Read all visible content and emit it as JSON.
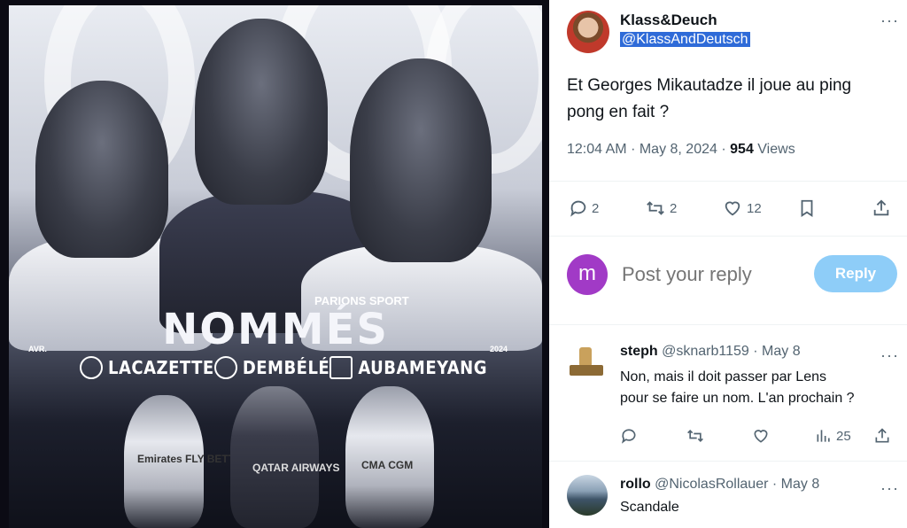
{
  "media": {
    "headline": "NOMMÉS",
    "players": [
      "LACAZETTE",
      "DEMBÉLÉ",
      "AUBAMEYANG"
    ],
    "sponsor": "PARIONS SPORT",
    "left_tag": "AVR.",
    "right_tag": "2024",
    "jersey_texts": [
      "Emirates FLY BETTER",
      "QATAR AIRWAYS",
      "CMA CGM"
    ]
  },
  "tweet": {
    "author_name": "Klass&Deuch",
    "author_handle": "@KlassAndDeutsch",
    "text_line1": "Et Georges Mikautadze il joue au ping",
    "text_line2": "pong en fait ?",
    "time": "12:04 AM",
    "date": "May 8, 2024",
    "sep": "·",
    "views_count": "954",
    "views_label": "Views",
    "replies": "2",
    "reposts": "2",
    "likes": "12",
    "more": "···"
  },
  "composer": {
    "avatar_letter": "m",
    "placeholder": "Post your reply",
    "button": "Reply",
    "avatar_color": "#a13ac6",
    "button_color": "#8ecdf8"
  },
  "replies": [
    {
      "name": "steph",
      "handle": "@sknarb1159",
      "date": "· May 8",
      "line1": "Non, mais il doit passer par Lens",
      "line2": "pour se faire un nom. L'an prochain ?",
      "views": "25"
    },
    {
      "name": "rollo",
      "handle": "@NicolasRollauer",
      "date": "· May 8",
      "line1": "Scandale"
    }
  ],
  "colors": {
    "accent": "#1d9bf0",
    "muted": "#536471",
    "selection": "#2f6bd8"
  },
  "icons": [
    "more-icon",
    "reply-icon",
    "repost-icon",
    "like-icon",
    "bookmark-icon",
    "share-icon",
    "views-icon"
  ]
}
